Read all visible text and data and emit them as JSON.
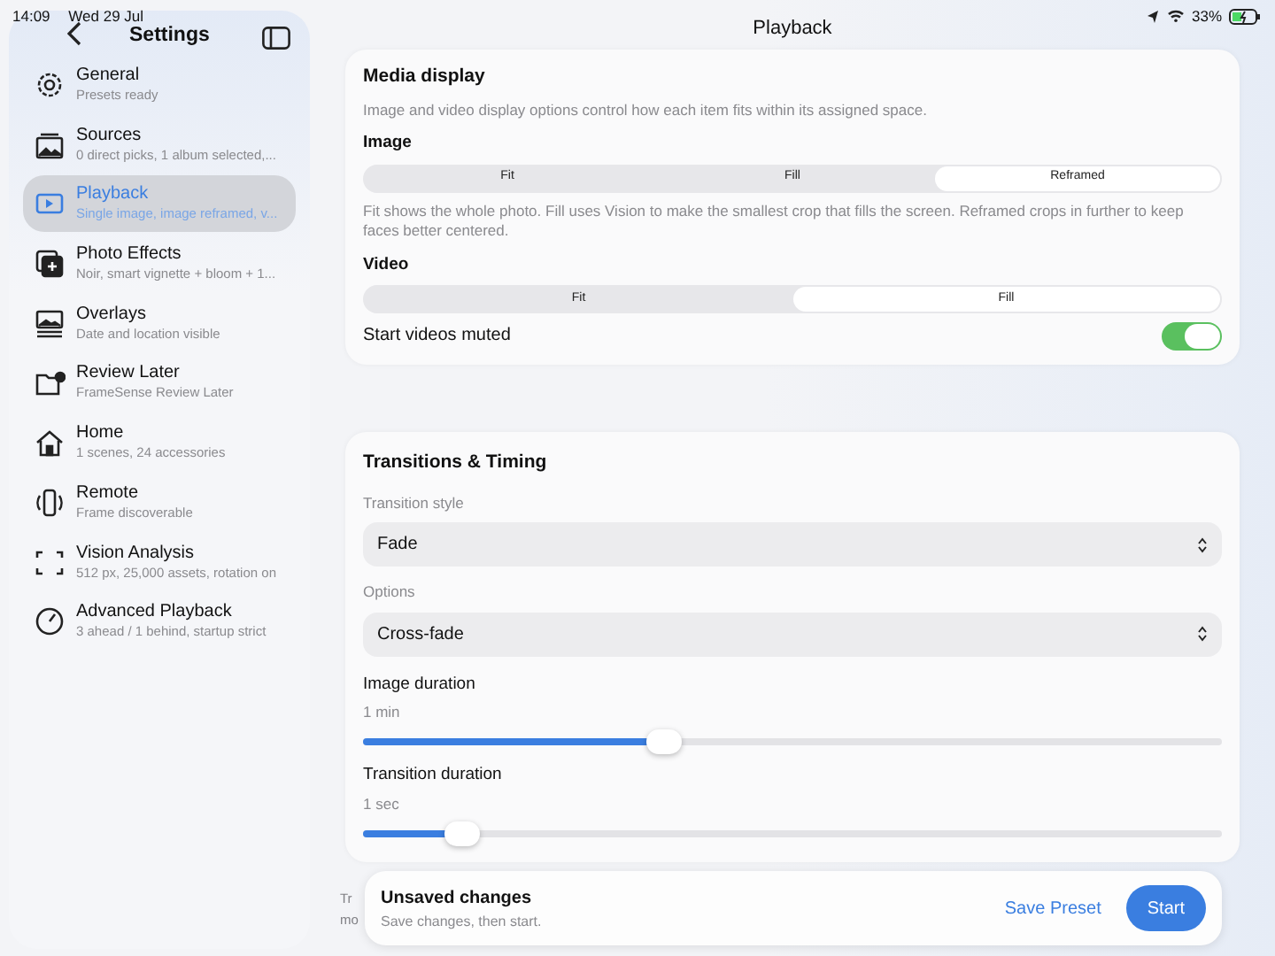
{
  "status_bar": {
    "time": "14:09",
    "date": "Wed 29 Jul",
    "battery": "33%"
  },
  "sidebar": {
    "title": "Settings",
    "items": [
      {
        "title": "General",
        "subtitle": "Presets ready",
        "selected": false
      },
      {
        "title": "Sources",
        "subtitle": "0 direct picks, 1 album selected,...",
        "selected": false
      },
      {
        "title": "Playback",
        "subtitle": "Single image, image reframed, v...",
        "selected": true
      },
      {
        "title": "Photo Effects",
        "subtitle": "Noir, smart vignette + bloom + 1...",
        "selected": false
      },
      {
        "title": "Overlays",
        "subtitle": "Date and location visible",
        "selected": false
      },
      {
        "title": "Review Later",
        "subtitle": "FrameSense Review Later",
        "selected": false
      },
      {
        "title": "Home",
        "subtitle": "1 scenes, 24 accessories",
        "selected": false
      },
      {
        "title": "Remote",
        "subtitle": "Frame discoverable",
        "selected": false
      },
      {
        "title": "Vision Analysis",
        "subtitle": "512 px, 25,000 assets, rotation on",
        "selected": false
      },
      {
        "title": "Advanced Playback",
        "subtitle": "3 ahead / 1 behind, startup strict",
        "selected": false
      }
    ]
  },
  "page_title": "Playback",
  "media_display": {
    "title": "Media display",
    "description": "Image and video display options control how each item fits within its assigned space.",
    "image": {
      "label": "Image",
      "segments": [
        {
          "label": "Fit",
          "selected": false
        },
        {
          "label": "Fill",
          "selected": false
        },
        {
          "label": "Reframed",
          "selected": true
        }
      ]
    },
    "image_note": "Fit shows the whole photo. Fill uses Vision to make the smallest crop that fills the screen. Reframed crops in further to keep faces better centered.",
    "video": {
      "label": "Video",
      "segments": [
        {
          "label": "Fit",
          "selected": false
        },
        {
          "label": "Fill",
          "selected": true
        }
      ]
    },
    "mute": {
      "label": "Start videos muted",
      "on": true
    }
  },
  "transitions": {
    "title": "Transitions & Timing",
    "selects": [
      {
        "label": "Transition style",
        "value": "Fade"
      },
      {
        "label": "Options",
        "value": "Cross-fade"
      }
    ],
    "sliders": [
      {
        "label": "Image duration",
        "reading": "1 min",
        "level": 0.35
      },
      {
        "label": "Transition duration",
        "reading": "1 sec",
        "level": 0.115
      }
    ]
  },
  "hidden_note": [
    "Tr",
    "mo"
  ],
  "toast": {
    "title": "Unsaved changes",
    "subtitle": "Save changes, then start.",
    "secondary": "Save Preset",
    "primary": "Start"
  }
}
